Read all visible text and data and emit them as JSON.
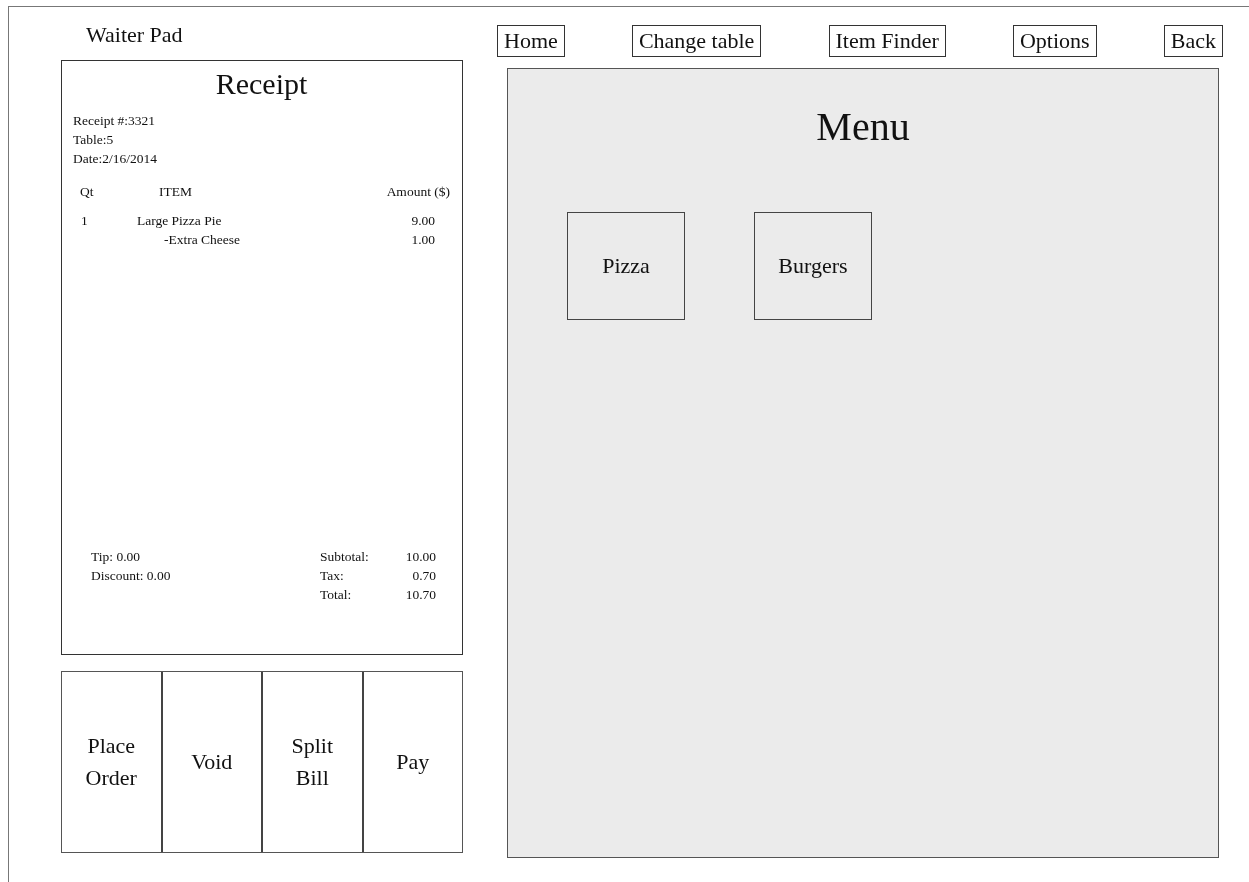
{
  "app_title": "Waiter Pad",
  "receipt": {
    "title": "Receipt",
    "info": [
      "Receipt #:3321",
      "Table:5",
      "Date:2/16/2014"
    ],
    "columns": [
      "Qt",
      "ITEM",
      "Amount ($)"
    ],
    "items": [
      {
        "qty": "1",
        "name": "Large Pizza Pie",
        "amount": "9.00",
        "modifiers": [
          {
            "name": "-Extra Cheese",
            "amount": "1.00"
          }
        ]
      }
    ],
    "adjustments": [
      "Tip: 0.00",
      "Discount: 0.00"
    ],
    "totals": [
      {
        "label": "Subtotal:",
        "value": "10.00"
      },
      {
        "label": "Tax:",
        "value": "0.70"
      },
      {
        "label": "Total:",
        "value": "10.70"
      }
    ]
  },
  "actions": [
    [
      "Place",
      "Order"
    ],
    [
      "Void"
    ],
    [
      "Split",
      "Bill"
    ],
    [
      "Pay"
    ]
  ],
  "nav": [
    "Home",
    "Change table",
    "Item Finder",
    "Options",
    "Back"
  ],
  "menu": {
    "title": "Menu",
    "categories": [
      "Pizza",
      "Burgers"
    ]
  }
}
